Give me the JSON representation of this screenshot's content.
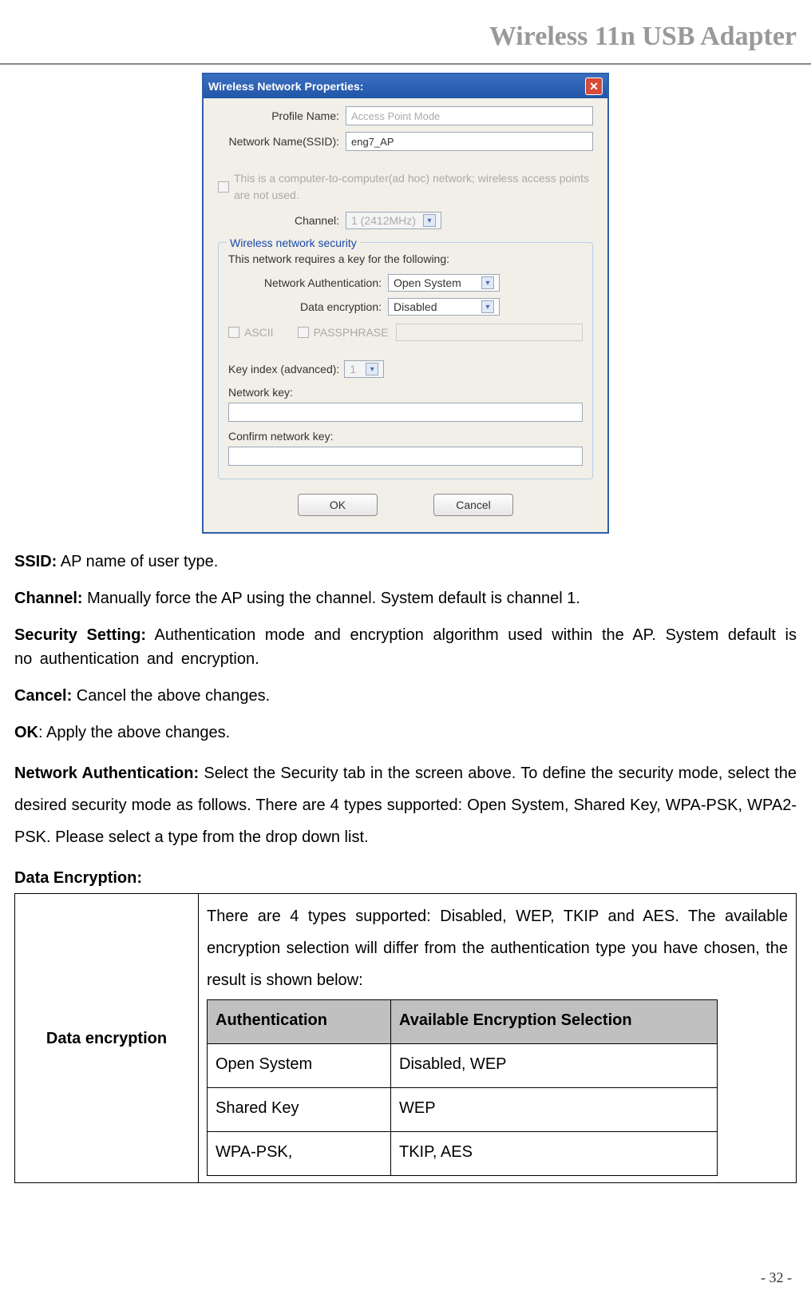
{
  "header": {
    "title": "Wireless 11n USB Adapter"
  },
  "dialog": {
    "title": "Wireless Network Properties:",
    "profile_name_label": "Profile Name:",
    "profile_name_value": "Access Point Mode",
    "ssid_label": "Network Name(SSID):",
    "ssid_value": "eng7_AP",
    "adhoc_text": "This is a computer-to-computer(ad hoc) network; wireless access points are not used.",
    "channel_label": "Channel:",
    "channel_value": "1 (2412MHz)",
    "security_legend": "Wireless network security",
    "security_desc": "This network requires a key for the following:",
    "netauth_label": "Network Authentication:",
    "netauth_value": "Open System",
    "dataenc_label": "Data encryption:",
    "dataenc_value": "Disabled",
    "ascii_label": "ASCII",
    "passphrase_label": "PASSPHRASE",
    "keyindex_label": "Key index (advanced):",
    "keyindex_value": "1",
    "networkkey_label": "Network key:",
    "confirmkey_label": "Confirm network key:",
    "ok_label": "OK",
    "cancel_label": "Cancel"
  },
  "defs": {
    "ssid": {
      "term": "SSID:",
      "text": " AP name of user type."
    },
    "channel": {
      "term": "Channel:",
      "text": " Manually force the AP using the channel. System default is channel 1."
    },
    "security": {
      "term": "Security Setting:",
      "text": " Authentication mode and encryption algorithm used within the AP. System default is no authentication and encryption."
    },
    "cancel": {
      "term": "Cancel:",
      "text": " Cancel the above changes."
    },
    "ok": {
      "term": "OK",
      "text": ": Apply the above changes."
    },
    "netauth": {
      "term": "Network Authentication:",
      "text": " Select the Security tab in the screen above. To define the security mode, select the desired security mode as follows. There are 4 types supported: Open System, Shared Key, WPA-PSK, WPA2-PSK. Please select a type from the drop down list."
    },
    "dataenc_header": "Data Encryption:"
  },
  "table": {
    "leftcell": "Data encryption",
    "desc": "There are 4 types supported: Disabled, WEP, TKIP and AES. The available encryption selection will differ from the authentication type you have chosen, the result is shown below:",
    "headers": {
      "auth": "Authentication",
      "avail": "Available Encryption Selection"
    },
    "rows": [
      {
        "auth": "Open System",
        "avail": "Disabled, WEP"
      },
      {
        "auth": "Shared Key",
        "avail": "WEP"
      },
      {
        "auth": "WPA-PSK,",
        "avail": "TKIP, AES"
      }
    ]
  },
  "footer": {
    "page": "- 32 -"
  }
}
